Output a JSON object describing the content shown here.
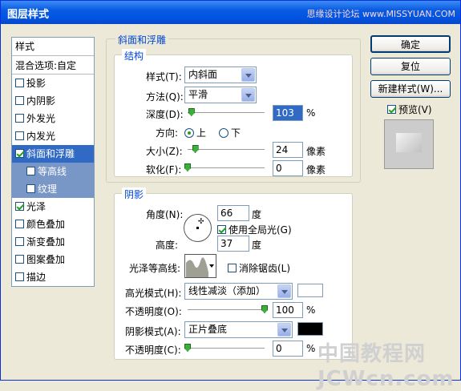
{
  "window": {
    "title": "图层样式",
    "watermark": "思缘设计论坛 www.MISSYUAN.COM"
  },
  "sidebar": {
    "items": [
      {
        "label": "样式",
        "checkbox": false,
        "checked": false
      },
      {
        "label": "混合选项:自定",
        "checkbox": false,
        "checked": false
      },
      {
        "label": "投影",
        "checkbox": true,
        "checked": false
      },
      {
        "label": "内阴影",
        "checkbox": true,
        "checked": false
      },
      {
        "label": "外发光",
        "checkbox": true,
        "checked": false
      },
      {
        "label": "内发光",
        "checkbox": true,
        "checked": false
      },
      {
        "label": "斜面和浮雕",
        "checkbox": true,
        "checked": true
      },
      {
        "label": "等高线",
        "checkbox": true,
        "checked": false
      },
      {
        "label": "纹理",
        "checkbox": true,
        "checked": false
      },
      {
        "label": "光泽",
        "checkbox": true,
        "checked": true
      },
      {
        "label": "颜色叠加",
        "checkbox": true,
        "checked": false
      },
      {
        "label": "渐变叠加",
        "checkbox": true,
        "checked": false
      },
      {
        "label": "图案叠加",
        "checkbox": true,
        "checked": false
      },
      {
        "label": "描边",
        "checkbox": true,
        "checked": false
      }
    ]
  },
  "bevel": {
    "group_title": "斜面和浮雕",
    "structure_title": "结构",
    "style_label": "样式(T):",
    "style_value": "内斜面",
    "technique_label": "方法(Q):",
    "technique_value": "平滑",
    "depth_label": "深度(D):",
    "depth_value": "103",
    "depth_unit": "%",
    "depth_level": 0.05,
    "direction_label": "方向:",
    "dir_up": "上",
    "dir_down": "下",
    "size_label": "大小(Z):",
    "size_value": "24",
    "size_unit": "像素",
    "size_level": 0.1,
    "soften_label": "软化(F):",
    "soften_value": "0",
    "soften_unit": "像素",
    "soften_level": 0
  },
  "shading": {
    "title": "阴影",
    "angle_label": "角度(N):",
    "angle_value": "66",
    "angle_unit": "度",
    "global_light_label": "使用全局光(G)",
    "altitude_label": "高度:",
    "altitude_value": "37",
    "altitude_unit": "度",
    "gloss_label": "光泽等高线:",
    "antialias_label": "消除锯齿(L)",
    "highlight_mode_label": "高光模式(H):",
    "highlight_mode_value": "线性减淡（添加）",
    "highlight_color": "#ffffff",
    "hl_opacity_label": "不透明度(O):",
    "hl_opacity_value": "100",
    "hl_opacity_unit": "%",
    "hl_opacity_level": 1.0,
    "shadow_mode_label": "阴影模式(A):",
    "shadow_mode_value": "正片叠底",
    "shadow_color": "#000000",
    "sh_opacity_label": "不透明度(C):",
    "sh_opacity_value": "0",
    "sh_opacity_unit": "%",
    "sh_opacity_level": 0
  },
  "buttons": {
    "ok": "确定",
    "reset": "复位",
    "new_style": "新建样式(W)...",
    "preview": "预览(V)"
  },
  "watermark_bottom": "中国教程网 JCWcn.com"
}
